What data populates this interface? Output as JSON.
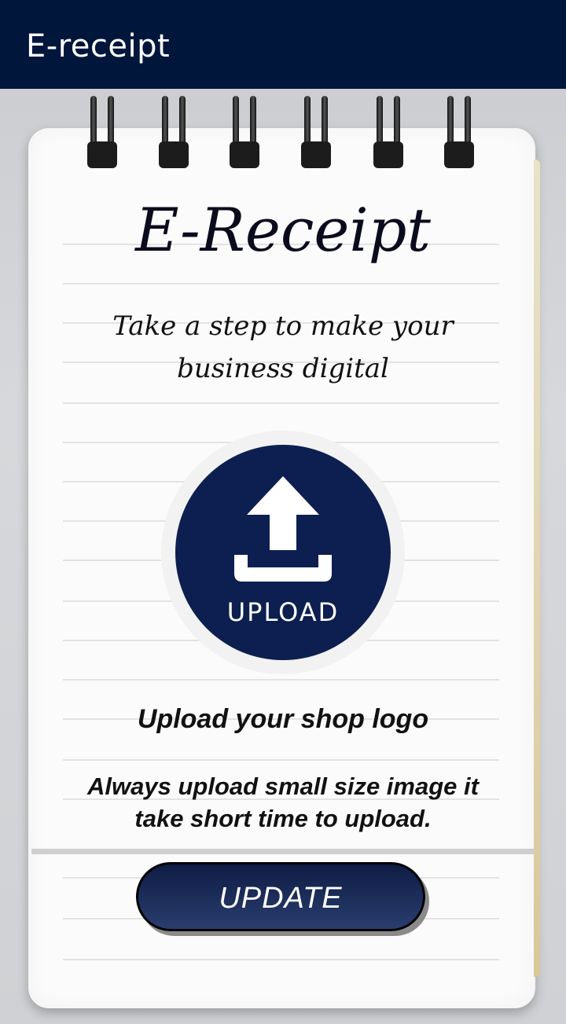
{
  "appbar": {
    "title": "E-receipt"
  },
  "notepad": {
    "title": "E-Receipt",
    "tagline_line1": "Take a step to make your",
    "tagline_line2": "business digital"
  },
  "upload": {
    "label": "UPLOAD",
    "icon": "upload-icon"
  },
  "info": {
    "heading": "Upload your shop logo",
    "note_line1": "Always upload small size image it",
    "note_line2": "take short time to upload."
  },
  "actions": {
    "update_label": "UPDATE"
  },
  "colors": {
    "appbar": "#00163a",
    "accent": "#0d1f50"
  }
}
